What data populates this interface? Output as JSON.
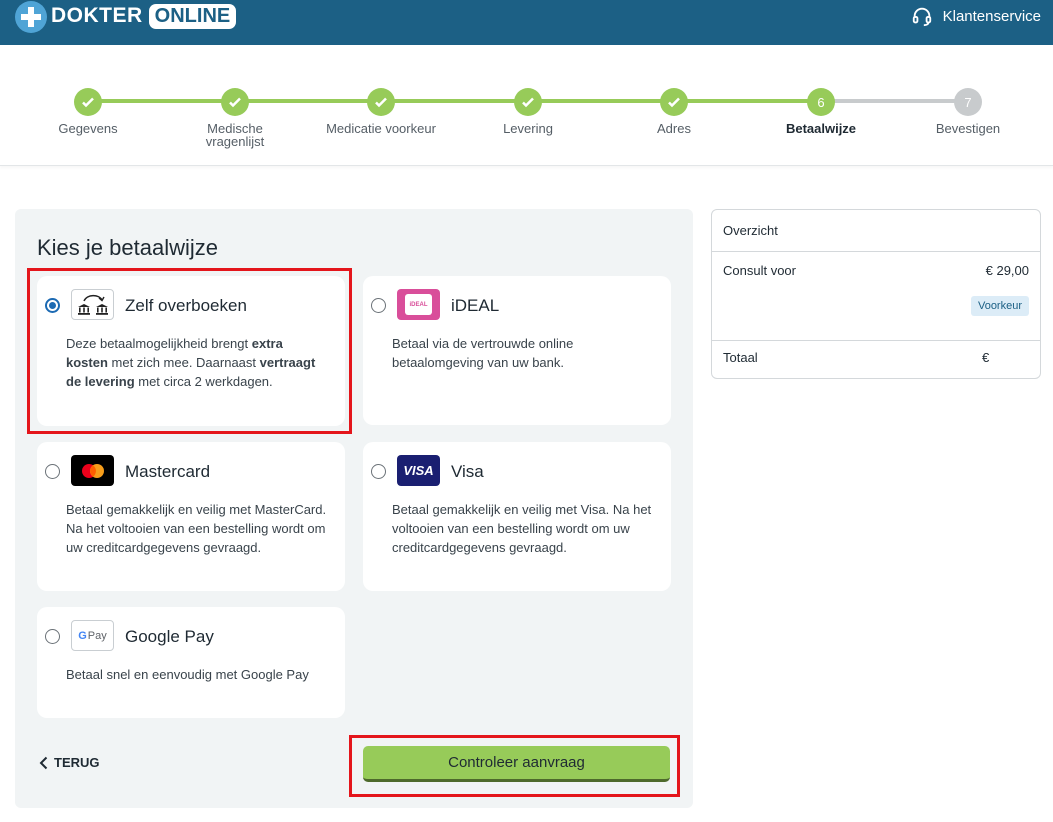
{
  "header": {
    "logo_dokter": "DOKTER",
    "logo_online": "ONLINE",
    "support_label": "Klantenservice"
  },
  "stepper": {
    "steps": [
      {
        "number": "1",
        "label": "Gegevens",
        "state": "done"
      },
      {
        "number": "2",
        "label": "Medische vragenlijst",
        "state": "done"
      },
      {
        "number": "3",
        "label": "Medicatie voorkeur",
        "state": "done"
      },
      {
        "number": "4",
        "label": "Levering",
        "state": "done"
      },
      {
        "number": "5",
        "label": "Adres",
        "state": "done"
      },
      {
        "number": "6",
        "label": "Betaalwijze",
        "state": "active"
      },
      {
        "number": "7",
        "label": "Bevestigen",
        "state": "todo"
      }
    ]
  },
  "payment": {
    "title": "Kies je betaalwijze",
    "methods": [
      {
        "name": "Zelf overboeken",
        "selected": true,
        "icon": "bank-transfer-icon",
        "desc_1": "Deze betaalmogelijkheid brengt ",
        "desc_2": "extra kosten",
        "desc_3": " met zich mee. Daarnaast ",
        "desc_4": "vertraagt de levering",
        "desc_5": " met circa 2 werkdagen."
      },
      {
        "name": "iDEAL",
        "selected": false,
        "icon": "ideal-icon",
        "desc": "Betaal via de vertrouwde online betaalomgeving van uw bank.",
        "icon_text": "iDEAL"
      },
      {
        "name": "Mastercard",
        "selected": false,
        "icon": "mastercard-icon",
        "desc": "Betaal gemakkelijk en veilig met MasterCard. Na het voltooien van een bestelling wordt om uw creditcardgegevens gevraagd."
      },
      {
        "name": "Visa",
        "selected": false,
        "icon": "visa-icon",
        "desc": "Betaal gemakkelijk en veilig met Visa. Na het voltooien van een bestelling wordt om uw creditcardgegevens gevraagd.",
        "icon_text": "VISA"
      },
      {
        "name": "Google Pay",
        "selected": false,
        "icon": "google-pay-icon",
        "desc": "Betaal snel en eenvoudig met Google Pay",
        "icon_text_g": "G",
        "icon_text_pay": "Pay"
      }
    ],
    "back_label": "TERUG",
    "submit_label": "Controleer aanvraag"
  },
  "overview": {
    "title": "Overzicht",
    "consult_label": "Consult voor",
    "consult_price": "€ 29,00",
    "badge": "Voorkeur",
    "total_label": "Totaal",
    "total_value": "€"
  },
  "colors": {
    "header": "#1c6085",
    "done": "#97cb59",
    "pending": "#c8cbcd",
    "highlight": "#e4151b",
    "cta": "#97cb59"
  }
}
